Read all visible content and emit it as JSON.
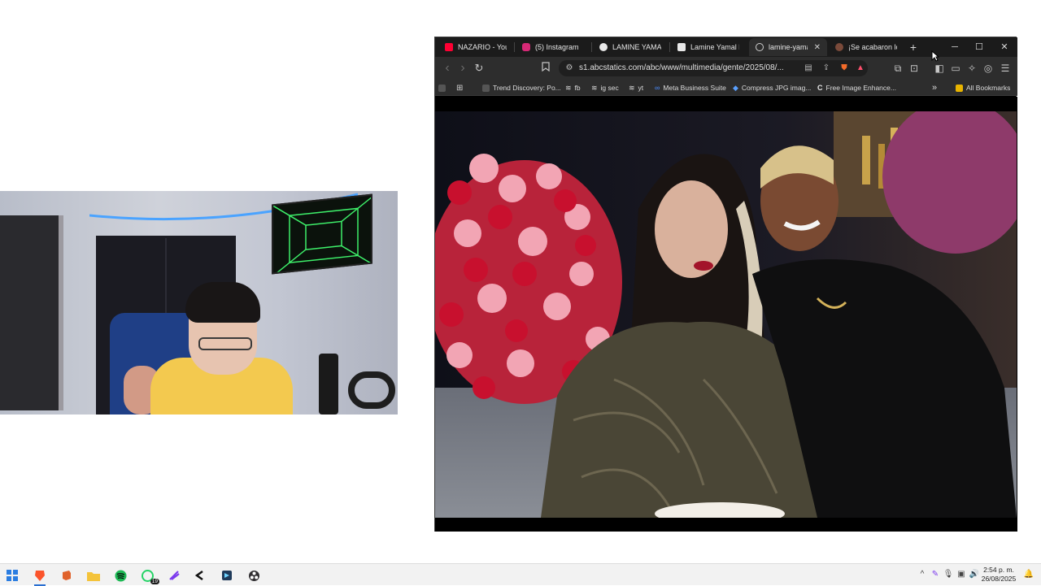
{
  "browser": {
    "tabs": [
      {
        "label": "NAZARIO - YouTu",
        "favicon": "youtube-icon",
        "color": "#ff0033"
      },
      {
        "label": "(5) Instagram",
        "favicon": "instagram-icon",
        "color": "#d62976"
      },
      {
        "label": "LAMINE YAMAL",
        "favicon": "chrome-icon",
        "color": "#e8e8e8"
      },
      {
        "label": "Lamine Yamal ha",
        "favicon": "page-icon",
        "color": "#e8e8e8"
      },
      {
        "label": "lamine-yama",
        "favicon": "globe-icon",
        "color": "#cfcfcf",
        "active": true
      },
      {
        "label": "¡Se acabaron los",
        "favicon": "site-icon",
        "color": "#7a4a3a"
      }
    ],
    "new_tab": "+",
    "window_controls": {
      "minimize": "─",
      "maximize": "☐",
      "close": "✕"
    },
    "toolbar": {
      "back": "‹",
      "forward": "›",
      "reload": "↻",
      "url": "s1.abcstatics.com/abc/www/multimedia/gente/2025/08/..."
    },
    "bookmarks": [
      {
        "label": "Trend Discovery: Po...",
        "icon": "trend-icon"
      },
      {
        "label": "fb",
        "icon": "layers-icon"
      },
      {
        "label": "ig sec",
        "icon": "layers-icon"
      },
      {
        "label": "yt",
        "icon": "layers-icon"
      },
      {
        "label": "Meta Business Suite",
        "icon": "meta-icon"
      },
      {
        "label": "Compress JPG imag...",
        "icon": "diamond-icon"
      },
      {
        "label": "Free Image Enhance...",
        "icon": "c-icon"
      }
    ],
    "all_bookmarks": "All Bookmarks",
    "more_bookmarks": "»"
  },
  "taskbar": {
    "apps": [
      {
        "name": "windows-start-icon"
      },
      {
        "name": "brave-browser-icon",
        "active": true
      },
      {
        "name": "office-icon"
      },
      {
        "name": "file-explorer-icon"
      },
      {
        "name": "spotify-icon"
      },
      {
        "name": "whatsapp-icon",
        "badge": "19"
      },
      {
        "name": "editor-icon"
      },
      {
        "name": "capcut-icon"
      },
      {
        "name": "media-app-icon"
      },
      {
        "name": "obs-icon"
      }
    ],
    "whatsapp_badge": "19",
    "time": "2:54 p. m.",
    "date": "26/08/2025"
  }
}
